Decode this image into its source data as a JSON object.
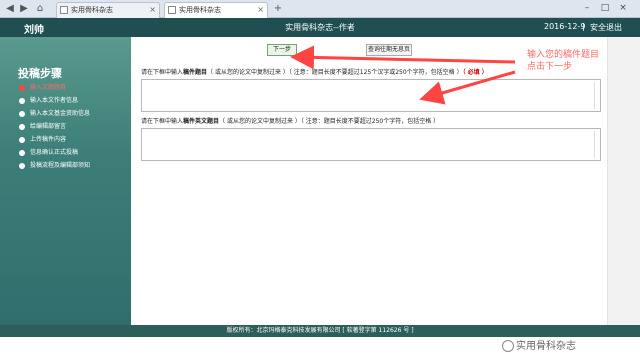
{
  "browser": {
    "tabs": [
      {
        "label": "实用骨科杂志",
        "active": false
      },
      {
        "label": "实用骨科杂志",
        "active": true
      }
    ]
  },
  "header": {
    "user": "刘帅",
    "title": "实用骨科杂志--作者",
    "date": "2016-12-9",
    "logout": "安全退出",
    "separator": "|"
  },
  "sidebar": {
    "title": "投稿步骤",
    "steps": [
      {
        "label": "输入文题题目",
        "current": true
      },
      {
        "label": "输入本文作者信息",
        "current": false
      },
      {
        "label": "输入本文基金资助信息",
        "current": false
      },
      {
        "label": "给编辑部留言",
        "current": false
      },
      {
        "label": "上传稿件内容",
        "current": false
      },
      {
        "label": "信息确认正式投稿",
        "current": false
      },
      {
        "label": "投稿流程及编辑部须知",
        "current": false
      }
    ]
  },
  "main": {
    "next_button": "下一步",
    "extra_button": "查询往期无息页",
    "cn_title": {
      "prefix": "请在下框中输入",
      "field": "稿件题目",
      "hint": "（ 或从您的论文中复制过来 ）（ 注意：题目长度不要超过125个汉字或250个字符，包括空格 ）",
      "required": "（ 必填 ）"
    },
    "en_title": {
      "prefix": "请在下框中输入",
      "field": "稿件英文题目",
      "hint": "（ 或从您的论文中复制过来 ）（ 注意：题目长度不要超过250个字符，包括空格 ）"
    }
  },
  "annotation": {
    "line1": "输入您的稿件题目",
    "line2": "点击下一步",
    "color": "#ff4444"
  },
  "footer": {
    "text": "版权所有：北京玛格泰克科技发展有限公司  [ 软著登字第 112626 号 ]"
  },
  "watermark": "实用骨科杂志",
  "colors": {
    "header": "#1f4f51",
    "sidebar": "#3c7f78",
    "footer": "#2d5f5a",
    "current_step": "#ff6a6a"
  }
}
